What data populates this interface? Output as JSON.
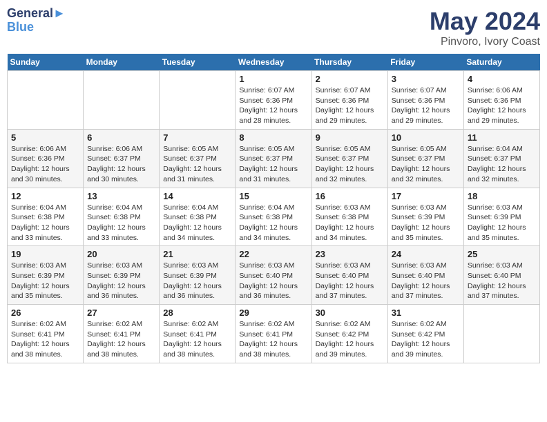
{
  "header": {
    "logo_line1": "General",
    "logo_line2": "Blue",
    "title": "May 2024",
    "subtitle": "Pinvoro, Ivory Coast"
  },
  "days_of_week": [
    "Sunday",
    "Monday",
    "Tuesday",
    "Wednesday",
    "Thursday",
    "Friday",
    "Saturday"
  ],
  "weeks": [
    [
      {
        "day": "",
        "info": ""
      },
      {
        "day": "",
        "info": ""
      },
      {
        "day": "",
        "info": ""
      },
      {
        "day": "1",
        "info": "Sunrise: 6:07 AM\nSunset: 6:36 PM\nDaylight: 12 hours\nand 28 minutes."
      },
      {
        "day": "2",
        "info": "Sunrise: 6:07 AM\nSunset: 6:36 PM\nDaylight: 12 hours\nand 29 minutes."
      },
      {
        "day": "3",
        "info": "Sunrise: 6:07 AM\nSunset: 6:36 PM\nDaylight: 12 hours\nand 29 minutes."
      },
      {
        "day": "4",
        "info": "Sunrise: 6:06 AM\nSunset: 6:36 PM\nDaylight: 12 hours\nand 29 minutes."
      }
    ],
    [
      {
        "day": "5",
        "info": "Sunrise: 6:06 AM\nSunset: 6:36 PM\nDaylight: 12 hours\nand 30 minutes."
      },
      {
        "day": "6",
        "info": "Sunrise: 6:06 AM\nSunset: 6:37 PM\nDaylight: 12 hours\nand 30 minutes."
      },
      {
        "day": "7",
        "info": "Sunrise: 6:05 AM\nSunset: 6:37 PM\nDaylight: 12 hours\nand 31 minutes."
      },
      {
        "day": "8",
        "info": "Sunrise: 6:05 AM\nSunset: 6:37 PM\nDaylight: 12 hours\nand 31 minutes."
      },
      {
        "day": "9",
        "info": "Sunrise: 6:05 AM\nSunset: 6:37 PM\nDaylight: 12 hours\nand 32 minutes."
      },
      {
        "day": "10",
        "info": "Sunrise: 6:05 AM\nSunset: 6:37 PM\nDaylight: 12 hours\nand 32 minutes."
      },
      {
        "day": "11",
        "info": "Sunrise: 6:04 AM\nSunset: 6:37 PM\nDaylight: 12 hours\nand 32 minutes."
      }
    ],
    [
      {
        "day": "12",
        "info": "Sunrise: 6:04 AM\nSunset: 6:38 PM\nDaylight: 12 hours\nand 33 minutes."
      },
      {
        "day": "13",
        "info": "Sunrise: 6:04 AM\nSunset: 6:38 PM\nDaylight: 12 hours\nand 33 minutes."
      },
      {
        "day": "14",
        "info": "Sunrise: 6:04 AM\nSunset: 6:38 PM\nDaylight: 12 hours\nand 34 minutes."
      },
      {
        "day": "15",
        "info": "Sunrise: 6:04 AM\nSunset: 6:38 PM\nDaylight: 12 hours\nand 34 minutes."
      },
      {
        "day": "16",
        "info": "Sunrise: 6:03 AM\nSunset: 6:38 PM\nDaylight: 12 hours\nand 34 minutes."
      },
      {
        "day": "17",
        "info": "Sunrise: 6:03 AM\nSunset: 6:39 PM\nDaylight: 12 hours\nand 35 minutes."
      },
      {
        "day": "18",
        "info": "Sunrise: 6:03 AM\nSunset: 6:39 PM\nDaylight: 12 hours\nand 35 minutes."
      }
    ],
    [
      {
        "day": "19",
        "info": "Sunrise: 6:03 AM\nSunset: 6:39 PM\nDaylight: 12 hours\nand 35 minutes."
      },
      {
        "day": "20",
        "info": "Sunrise: 6:03 AM\nSunset: 6:39 PM\nDaylight: 12 hours\nand 36 minutes."
      },
      {
        "day": "21",
        "info": "Sunrise: 6:03 AM\nSunset: 6:39 PM\nDaylight: 12 hours\nand 36 minutes."
      },
      {
        "day": "22",
        "info": "Sunrise: 6:03 AM\nSunset: 6:40 PM\nDaylight: 12 hours\nand 36 minutes."
      },
      {
        "day": "23",
        "info": "Sunrise: 6:03 AM\nSunset: 6:40 PM\nDaylight: 12 hours\nand 37 minutes."
      },
      {
        "day": "24",
        "info": "Sunrise: 6:03 AM\nSunset: 6:40 PM\nDaylight: 12 hours\nand 37 minutes."
      },
      {
        "day": "25",
        "info": "Sunrise: 6:03 AM\nSunset: 6:40 PM\nDaylight: 12 hours\nand 37 minutes."
      }
    ],
    [
      {
        "day": "26",
        "info": "Sunrise: 6:02 AM\nSunset: 6:41 PM\nDaylight: 12 hours\nand 38 minutes."
      },
      {
        "day": "27",
        "info": "Sunrise: 6:02 AM\nSunset: 6:41 PM\nDaylight: 12 hours\nand 38 minutes."
      },
      {
        "day": "28",
        "info": "Sunrise: 6:02 AM\nSunset: 6:41 PM\nDaylight: 12 hours\nand 38 minutes."
      },
      {
        "day": "29",
        "info": "Sunrise: 6:02 AM\nSunset: 6:41 PM\nDaylight: 12 hours\nand 38 minutes."
      },
      {
        "day": "30",
        "info": "Sunrise: 6:02 AM\nSunset: 6:42 PM\nDaylight: 12 hours\nand 39 minutes."
      },
      {
        "day": "31",
        "info": "Sunrise: 6:02 AM\nSunset: 6:42 PM\nDaylight: 12 hours\nand 39 minutes."
      },
      {
        "day": "",
        "info": ""
      }
    ]
  ]
}
